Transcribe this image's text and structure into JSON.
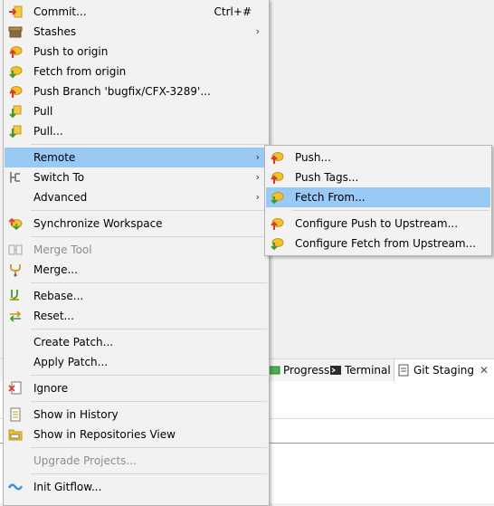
{
  "background": {
    "tabs": [
      {
        "label": "Progress",
        "icon": "progress-icon"
      },
      {
        "label": "Terminal",
        "icon": "terminal-icon"
      },
      {
        "label": "Git Staging",
        "icon": "git-staging-icon"
      }
    ]
  },
  "main_menu": {
    "items": [
      {
        "label": "Commit...",
        "accel": "Ctrl+#",
        "icon": "commit-icon"
      },
      {
        "label": "Stashes",
        "icon": "stashes-icon",
        "submenu": true
      },
      {
        "label": "Push to origin",
        "icon": "push-icon"
      },
      {
        "label": "Fetch from origin",
        "icon": "fetch-icon"
      },
      {
        "label": "Push Branch 'bugfix/CFX-3289'...",
        "icon": "push-branch-icon"
      },
      {
        "label": "Pull",
        "icon": "pull-icon"
      },
      {
        "label": "Pull...",
        "icon": "pull-dialog-icon"
      },
      {
        "label": "Remote",
        "highlighted": true,
        "submenu": true
      },
      {
        "label": "Switch To",
        "icon": "switch-icon",
        "submenu": true
      },
      {
        "label": "Advanced",
        "submenu": true
      },
      {
        "label": "Synchronize Workspace",
        "icon": "synchronize-icon"
      },
      {
        "label": "Merge Tool",
        "icon": "merge-tool-icon",
        "disabled": true
      },
      {
        "label": "Merge...",
        "icon": "merge-icon"
      },
      {
        "label": "Rebase...",
        "icon": "rebase-icon"
      },
      {
        "label": "Reset...",
        "icon": "reset-icon"
      },
      {
        "label": "Create Patch..."
      },
      {
        "label": "Apply Patch..."
      },
      {
        "label": "Ignore",
        "icon": "ignore-icon"
      },
      {
        "label": "Show in History",
        "icon": "history-icon"
      },
      {
        "label": "Show in Repositories View",
        "icon": "repositories-icon"
      },
      {
        "label": "Upgrade Projects...",
        "disabled": true
      },
      {
        "label": "Init Gitflow...",
        "icon": "gitflow-icon"
      }
    ]
  },
  "remote_submenu": {
    "items": [
      {
        "label": "Push...",
        "icon": "push-icon"
      },
      {
        "label": "Push Tags...",
        "icon": "push-tags-icon"
      },
      {
        "label": "Fetch From...",
        "icon": "fetch-icon",
        "highlighted": true
      },
      {
        "label": "Configure Push to Upstream...",
        "icon": "configure-push-icon"
      },
      {
        "label": "Configure Fetch from Upstream...",
        "icon": "configure-fetch-icon"
      }
    ]
  },
  "colors": {
    "highlight": "#99c9f5",
    "menu_bg": "#f2f2f2",
    "icon_yellow": "#f2c12e",
    "arrow_red": "#d63a2a",
    "arrow_green": "#3e9b2f"
  }
}
